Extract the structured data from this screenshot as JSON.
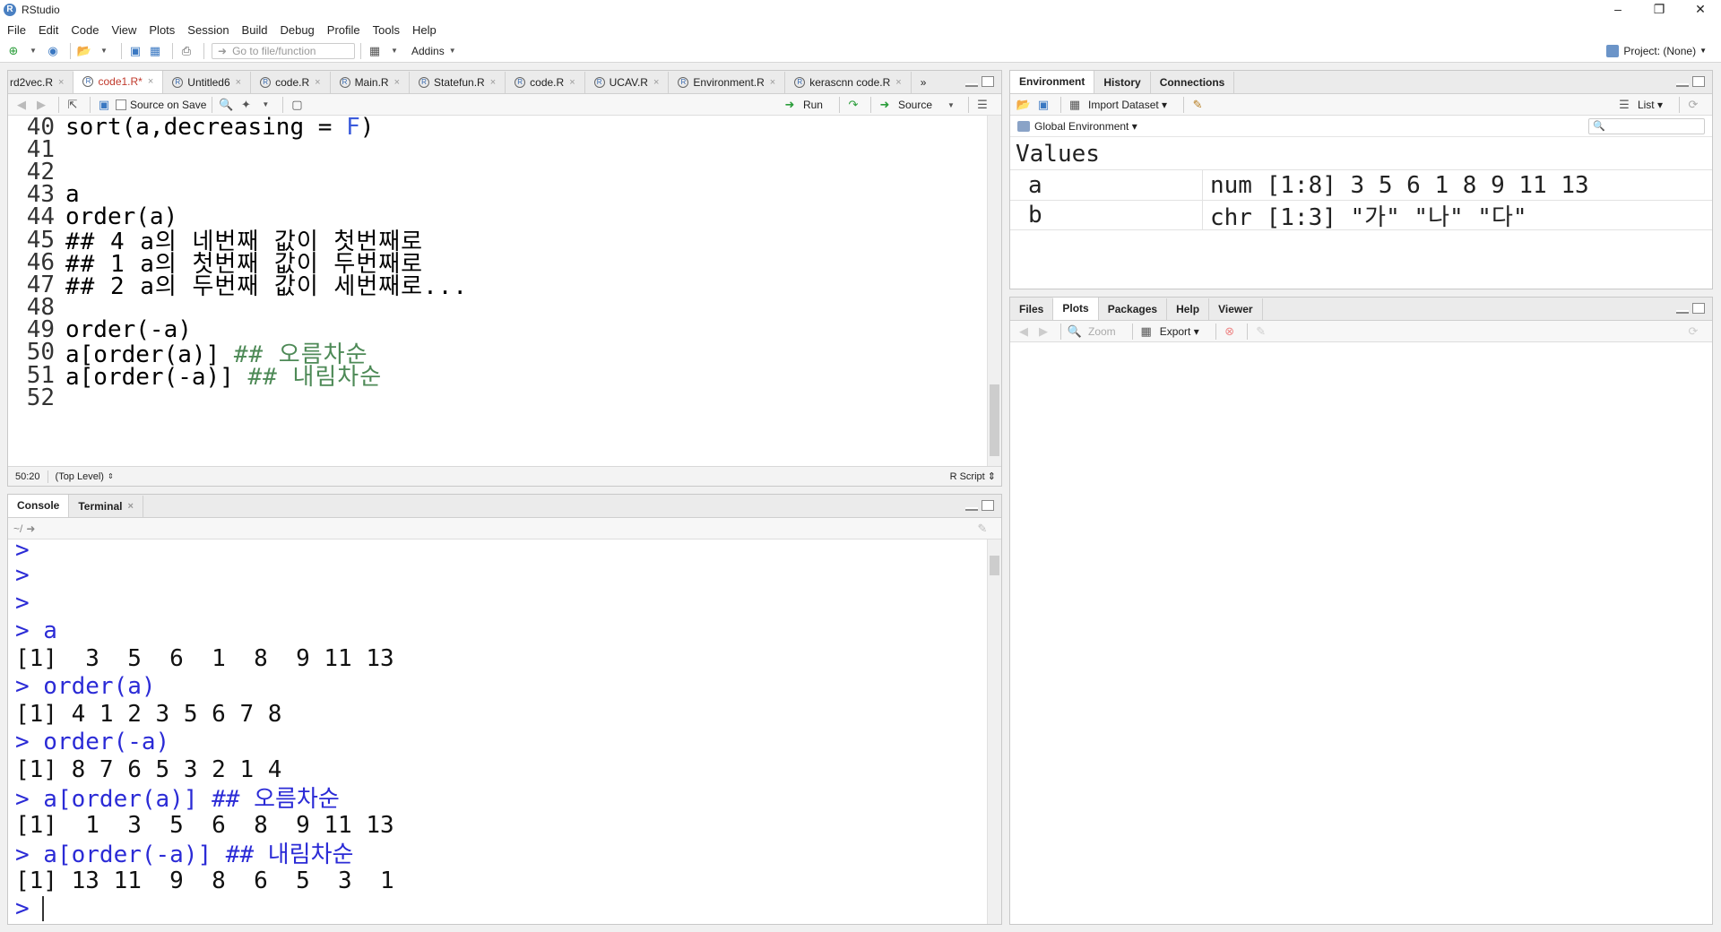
{
  "window": {
    "title": "RStudio"
  },
  "menubar": [
    "File",
    "Edit",
    "Code",
    "View",
    "Plots",
    "Session",
    "Build",
    "Debug",
    "Profile",
    "Tools",
    "Help"
  ],
  "toolbar": {
    "goto_placeholder": "Go to file/function",
    "addins": "Addins",
    "project": "Project: (None)"
  },
  "editor": {
    "tabs": [
      {
        "label": "rd2vec.R"
      },
      {
        "label": "code1.R*",
        "active": true
      },
      {
        "label": "Untitled6"
      },
      {
        "label": "code.R"
      },
      {
        "label": "Main.R"
      },
      {
        "label": "Statefun.R"
      },
      {
        "label": "code.R"
      },
      {
        "label": "UCAV.R"
      },
      {
        "label": "Environment.R"
      },
      {
        "label": "kerascnn code.R"
      }
    ],
    "source_on_save": "Source on Save",
    "run": "Run",
    "source": "Source",
    "lines": [
      {
        "n": "40",
        "code": "sort(a,decreasing = F)"
      },
      {
        "n": "41",
        "code": ""
      },
      {
        "n": "42",
        "code": ""
      },
      {
        "n": "43",
        "code": "a"
      },
      {
        "n": "44",
        "code": "order(a)"
      },
      {
        "n": "45",
        "code": "## 4 a의 네번째 값이 첫번째로"
      },
      {
        "n": "46",
        "code": "## 1 a의 첫번째 값이 두번째로"
      },
      {
        "n": "47",
        "code": "## 2 a의 두번째 값이 세번째로..."
      },
      {
        "n": "48",
        "code": ""
      },
      {
        "n": "49",
        "code": "order(-a)"
      },
      {
        "n": "50",
        "code": "a[order(a)] ## 오름차순"
      },
      {
        "n": "51",
        "code": "a[order(-a)] ## 내림차순"
      },
      {
        "n": "52",
        "code": ""
      }
    ],
    "status": {
      "position": "50:20",
      "scope": "(Top Level)",
      "filetype": "R Script"
    }
  },
  "console": {
    "tabs": [
      "Console",
      "Terminal"
    ],
    "path": "~/",
    "lines": [
      {
        "kind": "prompt",
        "text": ">"
      },
      {
        "kind": "prompt",
        "text": ">"
      },
      {
        "kind": "prompt",
        "text": ">"
      },
      {
        "kind": "cmd",
        "text": "> a"
      },
      {
        "kind": "out",
        "text": "[1]  3  5  6  1  8  9 11 13"
      },
      {
        "kind": "cmd",
        "text": "> order(a)"
      },
      {
        "kind": "out",
        "text": "[1] 4 1 2 3 5 6 7 8"
      },
      {
        "kind": "cmd",
        "text": "> order(-a)"
      },
      {
        "kind": "out",
        "text": "[1] 8 7 6 5 3 2 1 4"
      },
      {
        "kind": "cmd",
        "text": "> a[order(a)] ## 오름차순"
      },
      {
        "kind": "out",
        "text": "[1]  1  3  5  6  8  9 11 13"
      },
      {
        "kind": "cmd",
        "text": "> a[order(-a)] ## 내림차순"
      },
      {
        "kind": "out",
        "text": "[1] 13 11  9  8  6  5  3  1"
      },
      {
        "kind": "prompt",
        "text": ">"
      }
    ]
  },
  "environment": {
    "tabs": [
      "Environment",
      "History",
      "Connections"
    ],
    "import_dataset": "Import Dataset",
    "view_mode": "List",
    "scope": "Global Environment",
    "section": "Values",
    "values": [
      {
        "name": "a",
        "value": "num [1:8] 3 5 6 1 8 9 11 13"
      },
      {
        "name": "b",
        "value": "chr [1:3] \"가\" \"나\" \"다\""
      }
    ]
  },
  "files": {
    "tabs": [
      "Files",
      "Plots",
      "Packages",
      "Help",
      "Viewer"
    ],
    "zoom": "Zoom",
    "export": "Export"
  }
}
